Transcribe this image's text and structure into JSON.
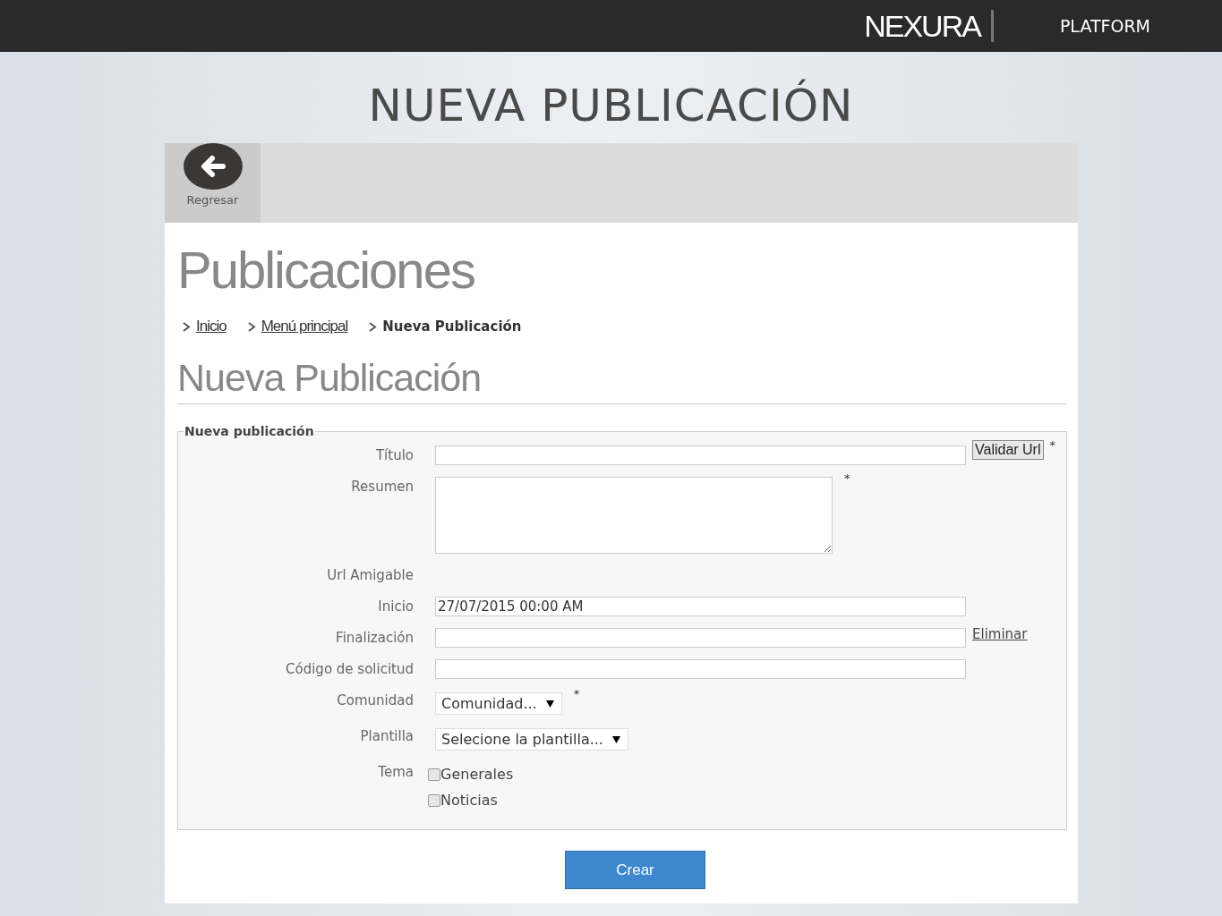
{
  "topbar": {
    "logo": "NEXURA",
    "product": "PLATFORM"
  },
  "slide_title": "NUEVA PUBLICACIÓN",
  "toolbar": {
    "back_label": "Regresar"
  },
  "heading": "Publicaciones",
  "breadcrumbs": [
    {
      "label": "Inicio",
      "link": true
    },
    {
      "label": "Menú principal",
      "link": true
    },
    {
      "label": "Nueva Publicación",
      "link": false
    }
  ],
  "subheading": "Nueva Publicación",
  "form": {
    "legend": "Nueva publicación",
    "fields": [
      {
        "kind": "text",
        "label": "Título",
        "button": "Validar Url",
        "mark": "*"
      },
      {
        "kind": "textarea",
        "label": "Resumen",
        "mark": "*"
      },
      {
        "kind": "static",
        "label": "Url Amigable"
      },
      {
        "kind": "text",
        "label": "Inicio",
        "value": "27/07/2015 00:00 AM"
      },
      {
        "kind": "text",
        "label": "Finalización",
        "link": "Eliminar"
      },
      {
        "kind": "text",
        "label": "Código de solicitud"
      },
      {
        "kind": "select",
        "label": "Comunidad",
        "value": "Comunidad...",
        "mark": "*"
      },
      {
        "kind": "select",
        "label": "Plantilla",
        "value": "Selecione la plantilla..."
      },
      {
        "kind": "checks",
        "label": "Tema",
        "options": [
          {
            "label": "Generales",
            "checked": false
          },
          {
            "label": "Noticias",
            "checked": false
          }
        ]
      }
    ]
  },
  "submit": "Crear"
}
